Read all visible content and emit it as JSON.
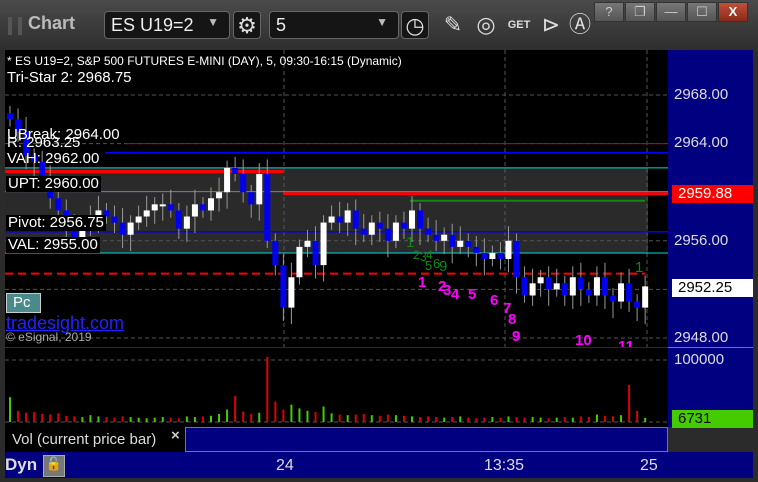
{
  "window": {
    "title": "Chart",
    "buttons": [
      "?",
      "❐",
      "—",
      "☐",
      "X"
    ]
  },
  "toolbar": {
    "symbol": "ES U19=2",
    "interval": "5",
    "icons": [
      "settings-icon",
      "clock-icon",
      "pencil-icon",
      "study-icon",
      "get-icon",
      "play-icon",
      "a-icon"
    ]
  },
  "chart": {
    "header": "* ES U19=2, S&P 500 FUTURES E-MINI (DAY), 5, 09:30-16:15 (Dynamic)",
    "level_labels": {
      "tristar": "Tri-Star 2: 2968.75",
      "ubreak": "UBreak: 2964.00",
      "r": "R: 2963.25",
      "vah": "VAH: 2962.00",
      "upt": "UPT: 2960.00",
      "pivot": "Pivot: 2956.75",
      "val": "VAL: 2955.00"
    },
    "price_ticks": [
      "2968.00",
      "2964.00",
      "2956.00",
      "2948.00"
    ],
    "last_price": "2952.25",
    "level_tag": "2959.88",
    "watermark": "tradesight.com",
    "copyright": "© eSignal, 2019",
    "pc_badge": "Pc",
    "magenta_counts": [
      "1",
      "2",
      "3",
      "4",
      "5",
      "6",
      "7",
      "8",
      "9",
      "10",
      "11"
    ],
    "green_counts": [
      "1",
      "2",
      "3",
      "4",
      "5",
      "6",
      "9",
      "1"
    ],
    "closes": [
      2966,
      2965,
      2963,
      2962.5,
      2961,
      2959.5,
      2958.5,
      2957,
      2956,
      2957.5,
      2958,
      2958.5,
      2958,
      2957.5,
      2956.5,
      2957.5,
      2958,
      2958.5,
      2959,
      2959,
      2958.5,
      2957,
      2958,
      2959,
      2958.5,
      2959.5,
      2960,
      2962,
      2961.5,
      2960,
      2959,
      2961.5,
      2956,
      2954,
      2950.5,
      2953,
      2955.5,
      2956,
      2954,
      2957.5,
      2958,
      2957.5,
      2958.5,
      2957,
      2956.5,
      2957.5,
      2957,
      2956,
      2957.5,
      2957,
      2958.5,
      2957,
      2956.5,
      2956,
      2956.5,
      2955.5,
      2956,
      2955.5,
      2955,
      2954.5,
      2955,
      2954.5,
      2956,
      2953,
      2951.5,
      2952.5,
      2953,
      2952,
      2952.5,
      2951.5,
      2953,
      2952,
      2951.5,
      2953,
      2951.5,
      2951,
      2952.5,
      2951,
      2950.5,
      2952.25
    ],
    "colors": {
      "up": "#ffffff",
      "down": "#0000ee",
      "axis": "#000080",
      "tag": "#ff0000"
    }
  },
  "volume": {
    "tick": "100000",
    "last": "6731",
    "label": "Vol (current price bar)",
    "close_icon": "×",
    "values": [
      40000,
      18000,
      15000,
      16000,
      13000,
      12000,
      14000,
      10000,
      9000,
      8000,
      11000,
      9000,
      8000,
      7000,
      9000,
      8000,
      7000,
      6000,
      7000,
      8000,
      7000,
      6000,
      9000,
      8000,
      9000,
      10000,
      13000,
      20000,
      42000,
      17000,
      13000,
      15000,
      105000,
      33000,
      20000,
      28000,
      22000,
      18000,
      16000,
      25000,
      14000,
      12000,
      11000,
      12000,
      13000,
      11000,
      10000,
      12000,
      11000,
      10000,
      9000,
      8000,
      9000,
      8000,
      7000,
      8000,
      9000,
      7000,
      6000,
      7000,
      8000,
      7000,
      9000,
      8000,
      7000,
      8000,
      7000,
      6000,
      7000,
      8000,
      7000,
      9000,
      8000,
      12000,
      10000,
      9000,
      11000,
      60000,
      18000,
      6731
    ],
    "colors": {
      "up": "#44cc00",
      "down": "#dd0000"
    }
  },
  "time_axis": {
    "mode": "Dyn",
    "labels": [
      "24",
      "13:35",
      "25"
    ]
  }
}
